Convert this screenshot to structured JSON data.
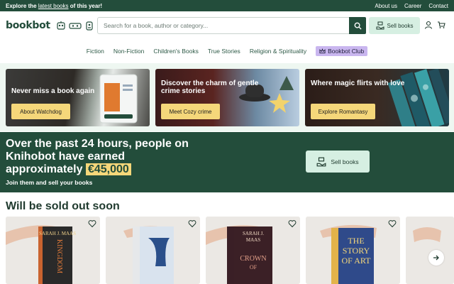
{
  "topbar": {
    "promo_prefix": "Explore the",
    "promo_link": "latest books",
    "promo_suffix": "of this year!",
    "links": [
      "About us",
      "Career",
      "Contact"
    ]
  },
  "header": {
    "logo": "bookbot",
    "search_placeholder": "Search for a book, author or category...",
    "sell_label": "Sell books"
  },
  "nav": {
    "items": [
      "Fiction",
      "Non-Fiction",
      "Children's Books",
      "True Stories",
      "Religion & Spirituality"
    ],
    "club_label": "Bookbot Club"
  },
  "promos": [
    {
      "title": "Never miss a book again",
      "cta": "About Watchdog"
    },
    {
      "title": "Discover the charm of gentle crime stories",
      "cta": "Meet Cozy crime"
    },
    {
      "title": "Where magic flirts with love",
      "cta": "Explore Romantasy"
    }
  ],
  "earnings": {
    "headline": "Over the past 24 hours, people on Knihobot have earned approximately",
    "amount": "€45,000",
    "sub": "Join them and sell your books",
    "cta": "Sell books"
  },
  "section": {
    "title": "Will be sold out soon"
  },
  "products": [
    {
      "author": "SARAH J. MAAS",
      "title": "KINGDOM OF ASH",
      "cover_color": "#2b2b2b"
    },
    {
      "author": "",
      "title": "",
      "cover_color": "#e9ecef"
    },
    {
      "author": "SARAH J. MAAS",
      "title": "CROWN OF MIDNIGHT",
      "cover_color": "#3a1f26"
    },
    {
      "author": "",
      "title": "THE STORY OF ART",
      "cover_color": "#2f4a8a"
    }
  ],
  "colors": {
    "brand_dark": "#234d3b",
    "mint": "#d6efe2",
    "yellow": "#f5d77a",
    "club": "#c9b6ef"
  }
}
